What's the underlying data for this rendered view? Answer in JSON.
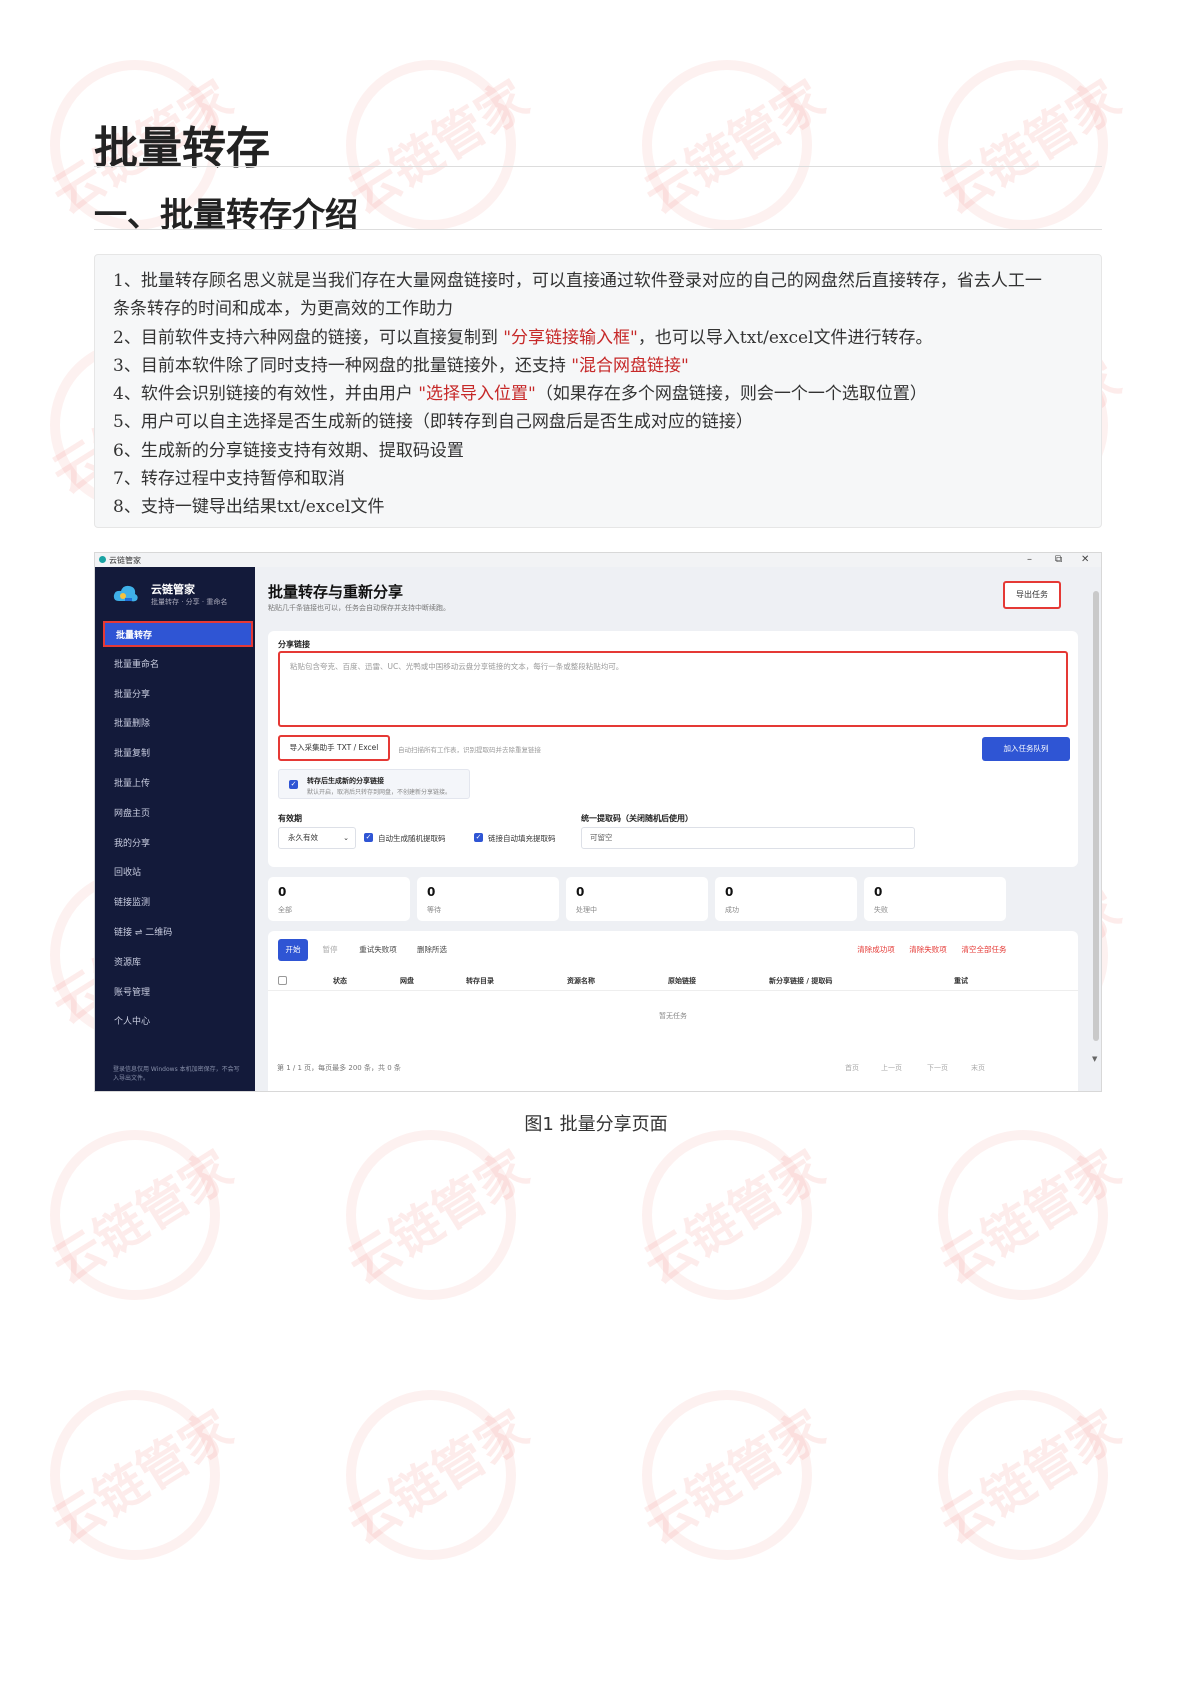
{
  "doc": {
    "title": "批量转存",
    "section": "一、批量转存介绍",
    "intro": [
      {
        "pre": "1、批量转存顾名思义就是当我们存在大量网盘链接时，可以直接通过软件登录对应的自己的网盘然后直接转存，省去人工一",
        "hl": "",
        "post": ""
      },
      {
        "pre": "条条转存的时间和成本，为更高效的工作助力",
        "hl": "",
        "post": ""
      },
      {
        "pre": "2、目前软件支持六种网盘的链接，可以直接复制到 ",
        "hl": "\"分享链接输入框\"",
        "post": "，也可以导入txt/excel文件进行转存。"
      },
      {
        "pre": "3、目前本软件除了同时支持一种网盘的批量链接外，还支持 ",
        "hl": "\"混合网盘链接\"",
        "post": ""
      },
      {
        "pre": "4、软件会识别链接的有效性，并由用户 ",
        "hl": "\"选择导入位置\"",
        "post": "（如果存在多个网盘链接，则会一个一个选取位置）"
      },
      {
        "pre": "5、用户可以自主选择是否生成新的链接（即转存到自己网盘后是否生成对应的链接）",
        "hl": "",
        "post": ""
      },
      {
        "pre": "6、生成新的分享链接支持有效期、提取码设置",
        "hl": "",
        "post": ""
      },
      {
        "pre": "7、转存过程中支持暂停和取消",
        "hl": "",
        "post": ""
      },
      {
        "pre": "8、支持一键导出结果txt/excel文件",
        "hl": "",
        "post": ""
      }
    ],
    "caption": "图1 批量分享页面",
    "watermark": "云链管家"
  },
  "app": {
    "window_title": "云链管家",
    "window_controls": [
      "–",
      "⧉",
      "✕"
    ],
    "brand_name": "云链管家",
    "brand_sub": "批量转存 · 分享 · 重命名",
    "nav": [
      "批量转存",
      "批量重命名",
      "批量分享",
      "批量删除",
      "批量复制",
      "批量上传",
      "网盘主页",
      "我的分享",
      "回收站",
      "链接监测",
      "链接 ⇌ 二维码",
      "资源库",
      "账号管理",
      "个人中心"
    ],
    "sidebar_footer": "登录信息仅用 Windows 本机加密保存，不会写入导出文件。",
    "page_title": "批量转存与重新分享",
    "page_subtitle": "粘贴几千条链接也可以，任务会自动保存并支持中断续跑。",
    "export_button": "导出任务",
    "share_link_label": "分享链接",
    "textarea_placeholder": "粘贴包含夸克、百度、迅雷、UC、光鸭或中国移动云盘分享链接的文本，每行一条或整段粘贴均可。",
    "import_button": "导入采集助手 TXT / Excel",
    "import_hint": "自动扫描所有工作表，识别提取码并去除重复链接",
    "queue_button": "加入任务队列",
    "regen_title": "转存后生成新的分享链接",
    "regen_sub": "默认开启，取消后只转存到网盘，不创建新分享链接。",
    "validity_label": "有效期",
    "validity_value": "永久有效",
    "auto_code_label": "自动生成随机提取码",
    "auto_fill_label": "链接自动填充提取码",
    "unified_code_label": "统一提取码（关闭随机后使用）",
    "unified_code_placeholder": "可留空",
    "stats": [
      {
        "n": "0",
        "l": "全部"
      },
      {
        "n": "0",
        "l": "等待"
      },
      {
        "n": "0",
        "l": "处理中"
      },
      {
        "n": "0",
        "l": "成功"
      },
      {
        "n": "0",
        "l": "失败"
      }
    ],
    "table_buttons": {
      "start": "开始",
      "pause": "暂停",
      "retry": "重试失败项",
      "delete": "删除所选",
      "clear_success": "清除成功项",
      "clear_failed": "清除失败项",
      "clear_all": "清空全部任务"
    },
    "columns": [
      "状态",
      "网盘",
      "转存目录",
      "资源名称",
      "原始链接",
      "新分享链接 / 提取码",
      "重试"
    ],
    "empty_text": "暂无任务",
    "pager": {
      "info": "第 1 / 1 页，每页最多 200 条，共 0 条",
      "first": "首页",
      "prev": "上一页",
      "next": "下一页",
      "last": "末页"
    }
  }
}
